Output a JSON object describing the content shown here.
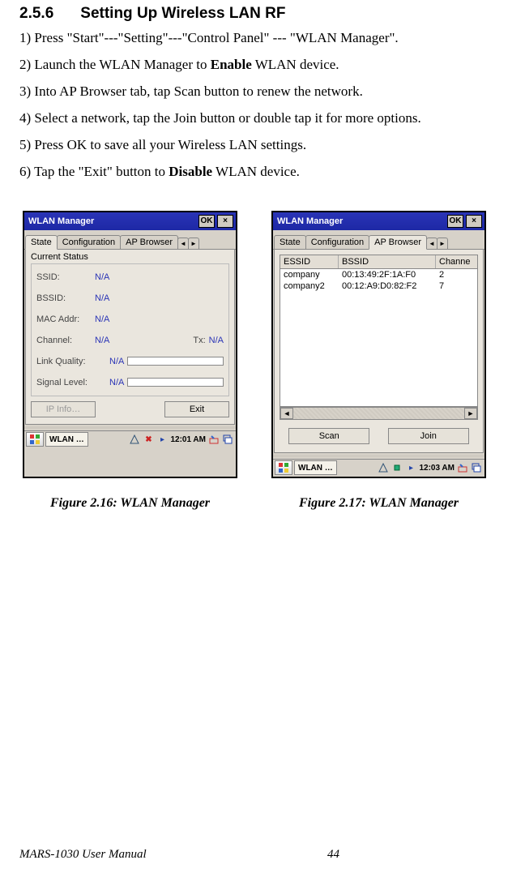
{
  "heading": {
    "num": "2.5.6",
    "title": "Setting Up Wireless LAN RF"
  },
  "steps": [
    "Press \"Start\"---\"Setting\"---\"Control Panel\" --- \"WLAN Manager\".",
    "Launch the WLAN Manager to <b>Enable</b> WLAN device.",
    "Into AP Browser tab, tap Scan button to renew the network.",
    "Select a network, tap the Join button or double tap it for more options.",
    "Press OK to save all your Wireless LAN settings.",
    "Tap the \"Exit\" button to <b>Disable</b> WLAN device."
  ],
  "left_window": {
    "title": "WLAN Manager",
    "ok": "OK",
    "tabs": [
      "State",
      "Configuration",
      "AP Browser"
    ],
    "group": "Current Status",
    "rows": {
      "ssid_label": "SSID:",
      "ssid_val": "N/A",
      "bssid_label": "BSSID:",
      "bssid_val": "N/A",
      "mac_label": "MAC Addr:",
      "mac_val": "N/A",
      "chan_label": "Channel:",
      "chan_val": "N/A",
      "tx_label": "Tx:",
      "tx_val": "N/A",
      "lq_label": "Link Quality:",
      "lq_val": "N/A",
      "sl_label": "Signal Level:",
      "sl_val": "N/A"
    },
    "ipinfo": "IP Info…",
    "exit": "Exit",
    "task": "WLAN …",
    "clock": "12:01 AM"
  },
  "right_window": {
    "title": "WLAN Manager",
    "ok": "OK",
    "tabs": [
      "State",
      "Configuration",
      "AP Browser"
    ],
    "columns": {
      "essid": "ESSID",
      "bssid": "BSSID",
      "channe": "Channe"
    },
    "rows": [
      {
        "essid": "company",
        "bssid": "00:13:49:2F:1A:F0",
        "ch": "2"
      },
      {
        "essid": "company2",
        "bssid": "00:12:A9:D0:82:F2",
        "ch": "7"
      }
    ],
    "scan": "Scan",
    "join": "Join",
    "task": "WLAN …",
    "clock": "12:03 AM"
  },
  "captions": {
    "left": "Figure 2.16: WLAN Manager",
    "right": "Figure 2.17: WLAN Manager"
  },
  "footer": {
    "manual": "MARS-1030 User Manual",
    "page": "44"
  }
}
